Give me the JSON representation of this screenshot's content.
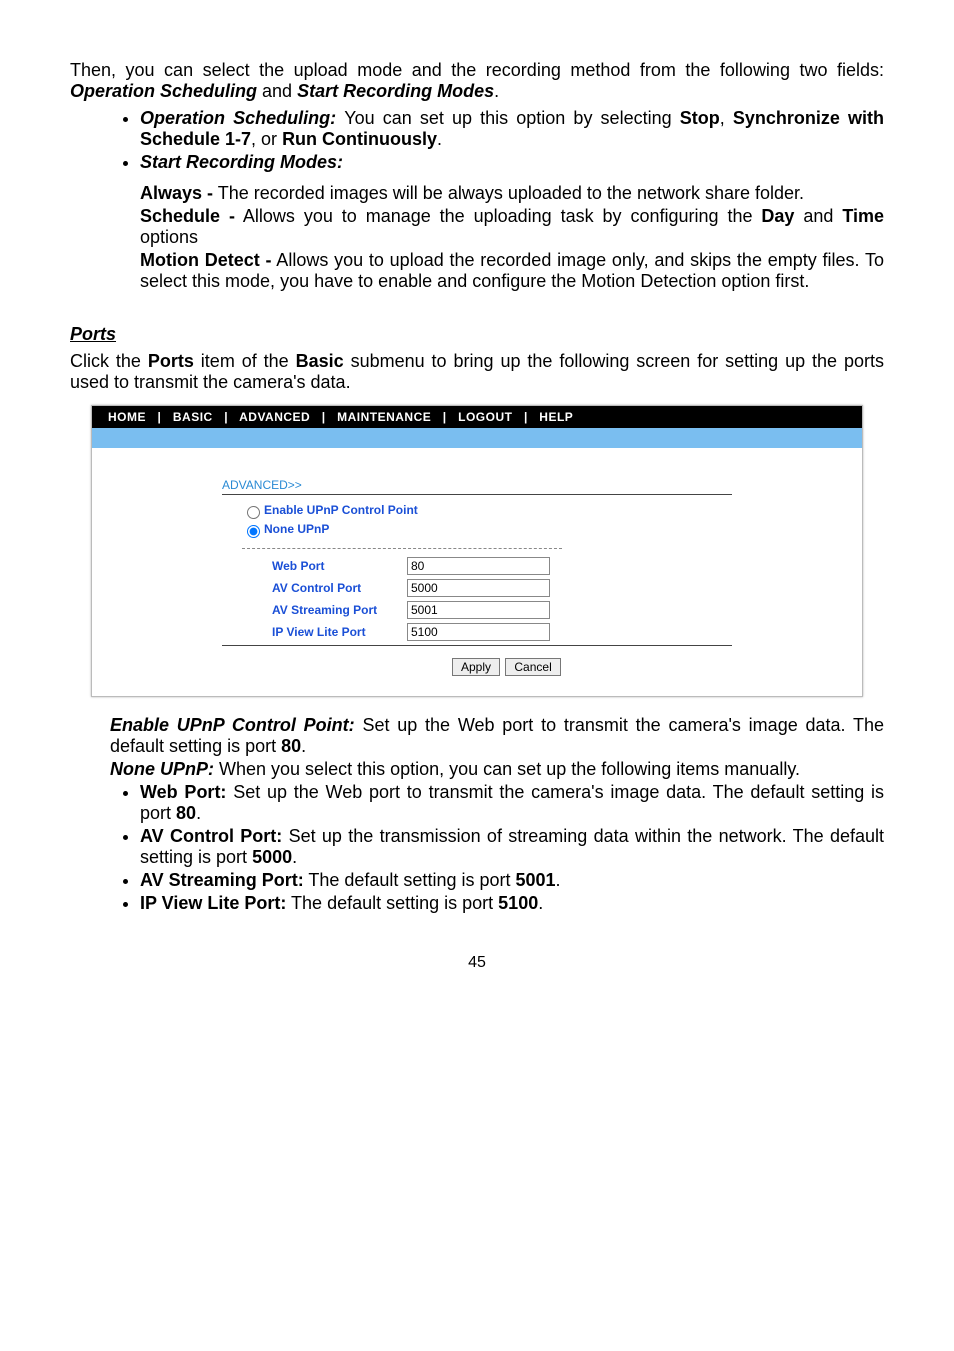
{
  "intro1": "Then, you can select the upload mode and the recording method from the following two fields: ",
  "intro1b": "Operation Scheduling",
  "intro1c": " and ",
  "intro1d": "Start Recording Modes",
  "intro1e": ".",
  "li1a": "Operation Scheduling: ",
  "li1b": "You can set up this option by selecting ",
  "li1c": "Stop",
  "li1d": ", ",
  "li1e": "Synchronize with Schedule 1-7",
  "li1f": ", or ",
  "li1g": "Run Continuously",
  "li1h": ".",
  "li2": "Start Recording Modes:",
  "sub1a": "Always -",
  "sub1b": " The recorded images will be always uploaded to the network share folder.",
  "sub2a": "Schedule -",
  "sub2b": " Allows you to manage the uploading task by configuring the ",
  "sub2c": "Day ",
  "sub2d": "and ",
  "sub2e": "Time",
  "sub2f": " options",
  "sub3a": "Motion Detect -",
  "sub3b": " Allows you to upload the recorded image only, and skips the empty files.  To select this mode, you have to enable and configure the Motion Detection option first.",
  "sec_title": "Ports",
  "sec_para_a": "Click the ",
  "sec_para_b": "Ports",
  "sec_para_c": " item of the ",
  "sec_para_d": "Basic",
  "sec_para_e": " submenu to bring up the following screen for setting up the ports used to transmit the camera's data.",
  "ui": {
    "menu": "HOME   |   BASIC   |   ADVANCED   |   MAINTENANCE   |   LOGOUT   |   HELP",
    "breadcrumb": "ADVANCED>>",
    "radio1": "Enable UPnP Control Point",
    "radio2": "None UPnP",
    "fields": {
      "web_label": "Web Port",
      "web_value": "80",
      "avc_label": "AV Control Port",
      "avc_value": "5000",
      "avs_label": "AV Streaming Port",
      "avs_value": "5001",
      "ipv_label": "IP View Lite Port",
      "ipv_value": "5100"
    },
    "btn_apply": "Apply",
    "btn_cancel": "Cancel"
  },
  "after1a": "Enable UPnP Control Point: ",
  "after1b": "Set up the Web port to transmit the camera's image data.  The default setting is port ",
  "after1c": "80",
  "after1d": ".",
  "after2a": "None UPnP: ",
  "after2b": "When you select this option, you can set up the following items manually.",
  "b1a": "Web Port:",
  "b1b": " Set up the Web port to transmit the camera's image data.  The default setting is port ",
  "b1c": "80",
  "b1d": ".",
  "b2a": "AV Control Port:",
  "b2b": " Set up the transmission of streaming data within the network.  The default setting is port ",
  "b2c": "5000",
  "b2d": ".",
  "b3a": "AV Streaming Port:",
  "b3b": " The default setting is port ",
  "b3c": "5001",
  "b3d": ".",
  "b4a": "IP View Lite Port:",
  "b4b": " The default setting is port ",
  "b4c": "5100",
  "b4d": ".",
  "pagenum": "45"
}
